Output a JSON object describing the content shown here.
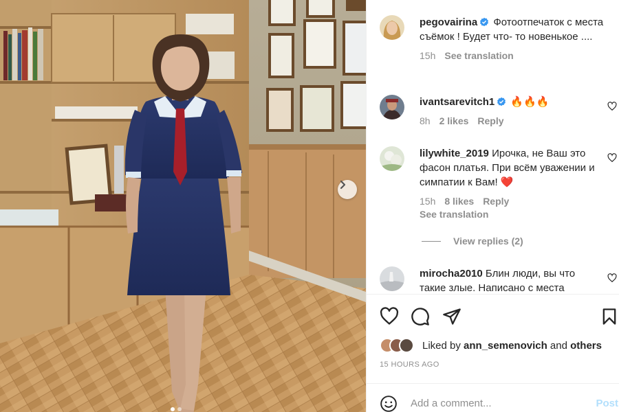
{
  "post": {
    "carousel": {
      "next_icon": "chevron-right-icon",
      "slide_count": 2,
      "active_slide": 1
    },
    "comments": [
      {
        "username": "pegovairina",
        "verified": true,
        "text": "Фотоотпечаток с места съёмок ! Будет что- то новенькое ....",
        "time": "15h",
        "see_translation": "See translation"
      },
      {
        "username": "ivantsarevitch1",
        "verified": true,
        "text": "🔥🔥🔥",
        "time": "8h",
        "likes": "2 likes",
        "reply": "Reply"
      },
      {
        "username": "lilywhite_2019",
        "verified": false,
        "text": "Ирочка, не Ваш это фасон платья. При всём уважении и симпатии к Вам! ❤️",
        "time": "15h",
        "likes": "8 likes",
        "reply": "Reply",
        "see_translation": "See translation"
      },
      {
        "username": "mirocha2010",
        "verified": false,
        "text": "Блин люди, вы что такие злые. Написано с места"
      }
    ],
    "view_replies": "View replies (2)",
    "liked_by_prefix": "Liked by ",
    "liked_by_user": "ann_semenovich",
    "liked_by_and": " and ",
    "liked_by_others": "others",
    "time_ago": "15 HOURS AGO",
    "add_comment_placeholder": "Add a comment...",
    "post_button": "Post"
  },
  "colors": {
    "verified_blue": "#3897f0",
    "post_disabled": "#b2dffc",
    "secondary_text": "#8e8e8e",
    "heart_red": "#ed4956"
  }
}
